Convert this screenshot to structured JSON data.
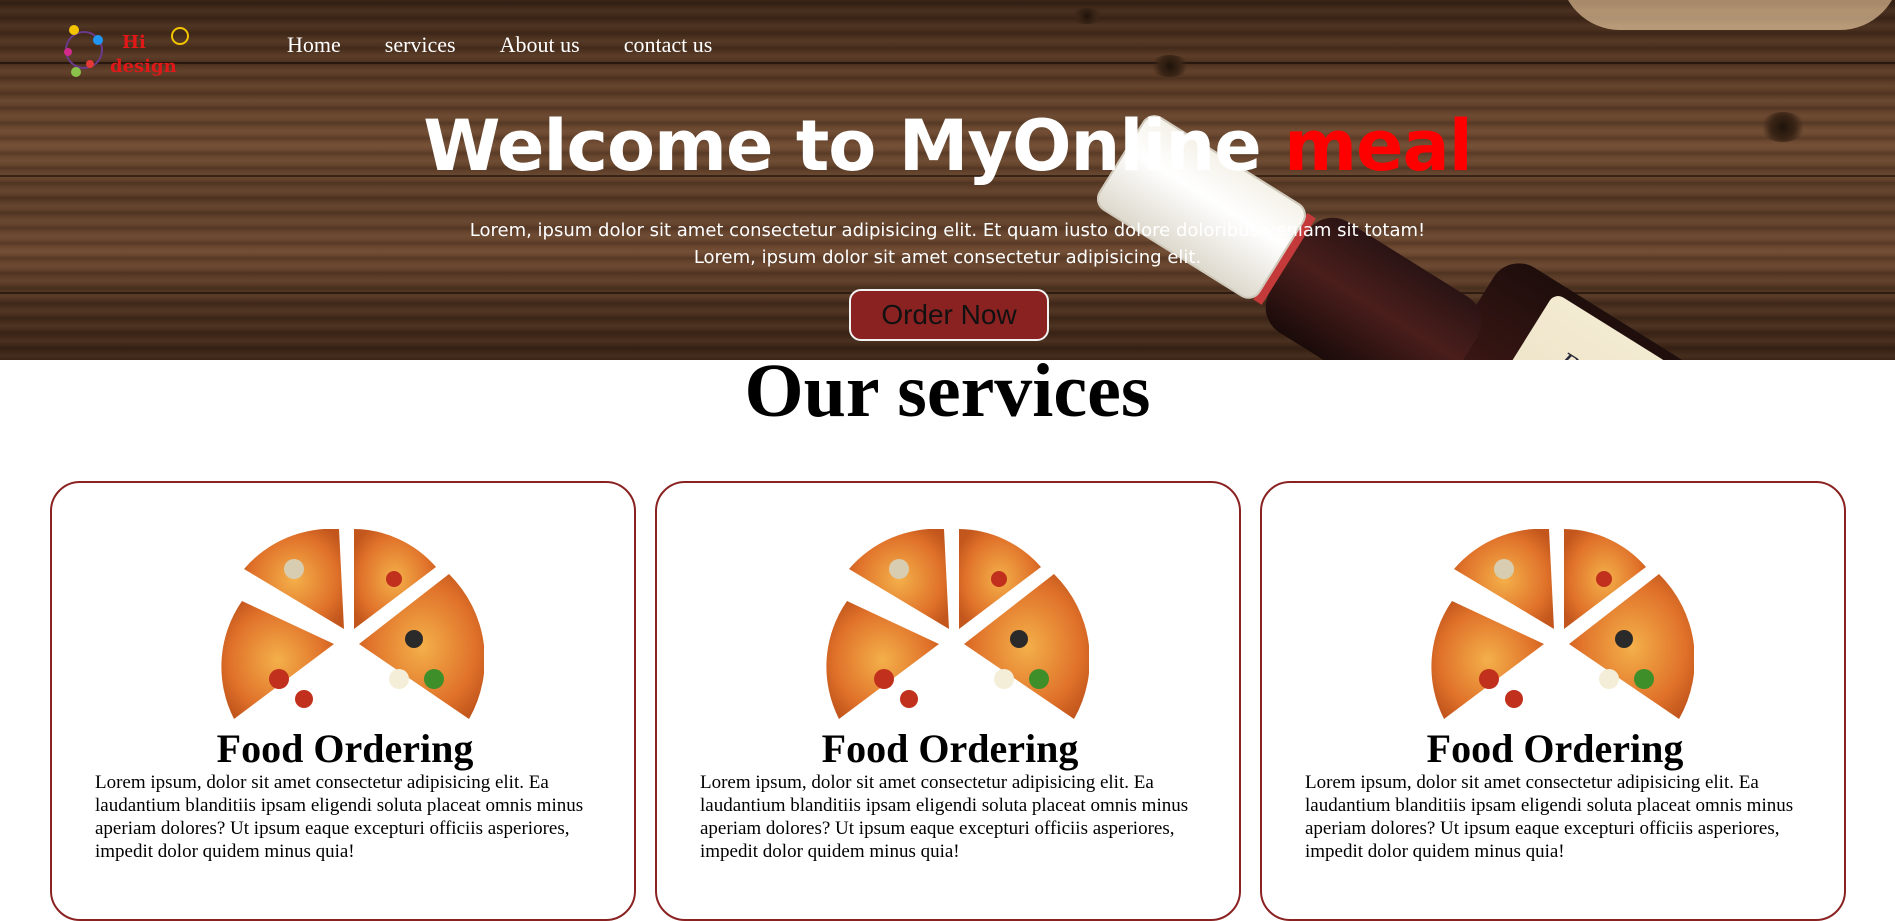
{
  "nav": {
    "logo_text_top": "Hi",
    "logo_text_bottom": "design",
    "items": [
      {
        "label": "Home"
      },
      {
        "label": "services"
      },
      {
        "label": "About us"
      },
      {
        "label": "contact us"
      }
    ]
  },
  "hero": {
    "title_main": "Welcome to MyOnline ",
    "title_accent": "meal",
    "subtitle_line1": "Lorem, ipsum dolor sit amet consectetur adipisicing elit. Et quam iusto dolore doloribus veniam sit totam!",
    "subtitle_line2": "Lorem, ipsum dolor sit amet consectetur adipisicing elit.",
    "button_label": "Order Now",
    "bottle_label": "Ballantine's"
  },
  "services": {
    "heading": "Our services",
    "cards": [
      {
        "title": "Food Ordering",
        "text": "Lorem ipsum, dolor sit amet consectetur adipisicing elit. Ea laudantium blanditiis ipsam eligendi soluta placeat omnis minus aperiam dolores? Ut ipsum eaque excepturi officiis asperiores, impedit dolor quidem minus quia!"
      },
      {
        "title": "Food Ordering",
        "text": "Lorem ipsum, dolor sit amet consectetur adipisicing elit. Ea laudantium blanditiis ipsam eligendi soluta placeat omnis minus aperiam dolores? Ut ipsum eaque excepturi officiis asperiores, impedit dolor quidem minus quia!"
      },
      {
        "title": "Food Ordering",
        "text": "Lorem ipsum, dolor sit amet consectetur adipisicing elit. Ea laudantium blanditiis ipsam eligendi soluta placeat omnis minus aperiam dolores? Ut ipsum eaque excepturi officiis asperiores, impedit dolor quidem minus quia!"
      }
    ]
  },
  "colors": {
    "accent": "#ff0000",
    "button_bg": "#8b2222",
    "card_border": "#8b2222"
  },
  "icons": [
    "logo-image",
    "pizza-image",
    "bottle-image"
  ]
}
